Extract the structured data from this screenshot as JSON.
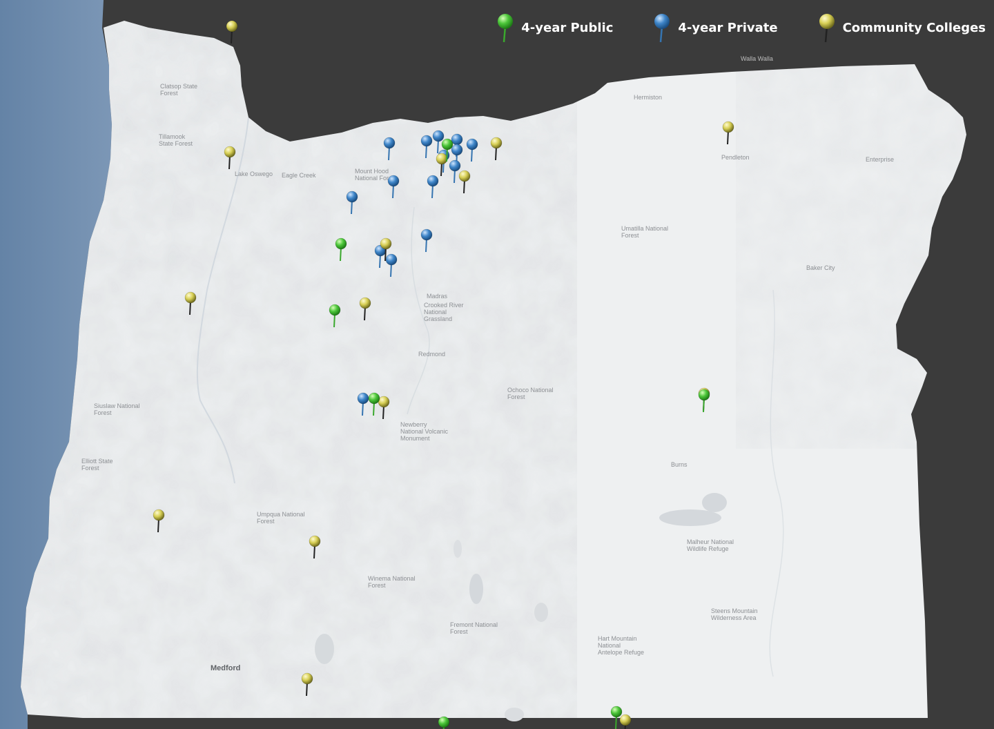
{
  "colors": {
    "ocean": "#6d8bab",
    "neighbor_land": "#3b3b3b",
    "state_land": "#eef0f1",
    "public_pin": "#4cc63a",
    "private_pin": "#3f86c9",
    "community_pin": "#d7cf55"
  },
  "legend": [
    {
      "key": "public",
      "label": "4-year Public",
      "icon": "green-pin-icon"
    },
    {
      "key": "private",
      "label": "4-year Private",
      "icon": "blue-pin-icon"
    },
    {
      "key": "community",
      "label": "Community Colleges",
      "icon": "yellow-pin-icon"
    }
  ],
  "place_labels": {
    "medford": "Medford",
    "walla_walla": "Walla Walla",
    "redmond": "Redmond",
    "burns": "Burns",
    "madras": "Madras",
    "hermiston": "Hermiston",
    "pendleton": "Pendleton",
    "enterprise": "Enterprise",
    "baker_city": "Baker City",
    "mount_hood": "Mount Hood National Forest",
    "umatilla": "Umatilla National Forest",
    "ochoco": "Ochoco National Forest",
    "malheur_refuge": "Malheur National Wildlife Refuge",
    "fremont": "Fremont National Forest",
    "winema": "Winema National Forest",
    "newberry": "Newberry National Volcanic Monument",
    "crooked_river": "Crooked River National Grassland",
    "siuslaw": "Siuslaw National Forest",
    "elliott": "Elliott State Forest",
    "tillamook": "Tillamook State Forest",
    "clatsop": "Clatsop State Forest",
    "umpqua": "Umpqua National Forest",
    "hart_mountain": "Hart Mountain National Antelope Refuge",
    "steens": "Steens Mountain Wilderness Area",
    "lake_oswego": "Lake Oswego",
    "eagle_creek": "Eagle Creek"
  },
  "colleges": {
    "public": [
      {
        "lat": 45.51,
        "lon": -122.68
      },
      {
        "lat": 44.94,
        "lon": -123.25
      },
      {
        "lat": 44.56,
        "lon": -123.28
      },
      {
        "lat": 44.05,
        "lon": -123.07
      },
      {
        "lat": 44.07,
        "lon": -121.31
      },
      {
        "lat": 45.32,
        "lon": -118.09
      },
      {
        "lat": 42.25,
        "lon": -121.78
      },
      {
        "lat": 42.19,
        "lon": -122.7
      }
    ],
    "private": [
      {
        "lat": 45.52,
        "lon": -122.99
      },
      {
        "lat": 45.56,
        "lon": -122.73
      },
      {
        "lat": 45.54,
        "lon": -122.63
      },
      {
        "lat": 45.48,
        "lon": -122.63
      },
      {
        "lat": 45.51,
        "lon": -122.55
      },
      {
        "lat": 45.53,
        "lon": -122.79
      },
      {
        "lat": 45.45,
        "lon": -122.7
      },
      {
        "lat": 45.39,
        "lon": -122.64
      },
      {
        "lat": 45.3,
        "lon": -122.97
      },
      {
        "lat": 45.3,
        "lon": -122.76
      },
      {
        "lat": 45.21,
        "lon": -123.19
      },
      {
        "lat": 44.99,
        "lon": -122.79
      },
      {
        "lat": 44.9,
        "lon": -123.04
      },
      {
        "lat": 44.85,
        "lon": -122.98
      },
      {
        "lat": 44.05,
        "lon": -123.13
      }
    ],
    "community": [
      {
        "lat": 46.19,
        "lon": -123.83
      },
      {
        "lat": 45.47,
        "lon": -123.84
      },
      {
        "lat": 45.52,
        "lon": -122.42
      },
      {
        "lat": 45.61,
        "lon": -121.18
      },
      {
        "lat": 45.86,
        "lon": -119.29
      },
      {
        "lat": 45.43,
        "lon": -122.71
      },
      {
        "lat": 45.33,
        "lon": -122.59
      },
      {
        "lat": 44.94,
        "lon": -123.01
      },
      {
        "lat": 44.63,
        "lon": -124.05
      },
      {
        "lat": 44.6,
        "lon": -123.12
      },
      {
        "lat": 44.03,
        "lon": -123.02
      },
      {
        "lat": 44.08,
        "lon": -121.31
      },
      {
        "lat": 43.99,
        "lon": -117.0
      },
      {
        "lat": 43.38,
        "lon": -124.22
      },
      {
        "lat": 43.23,
        "lon": -123.39
      },
      {
        "lat": 42.44,
        "lon": -123.43
      },
      {
        "lat": 42.2,
        "lon": -121.73
      }
    ]
  }
}
